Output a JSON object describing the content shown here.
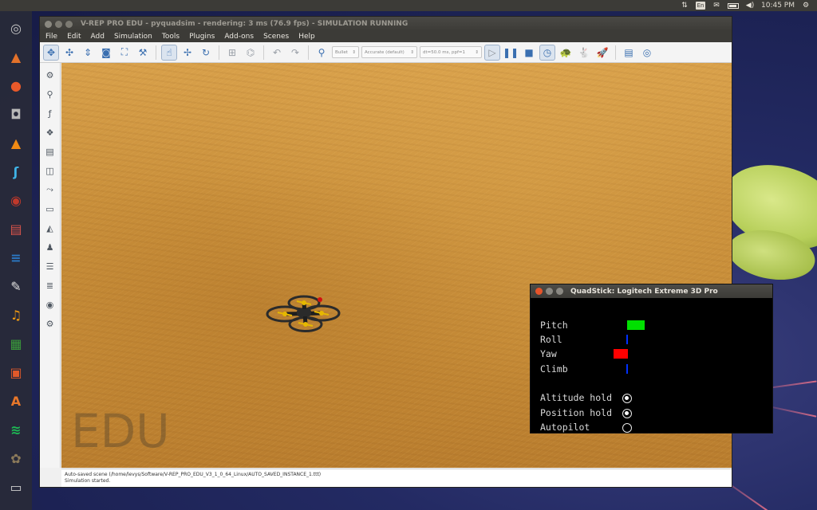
{
  "top_panel": {
    "keyboard_layout": "En",
    "clock": "10:45 PM",
    "icons": [
      "network-icon",
      "keyboard-icon",
      "mail-icon",
      "battery-icon",
      "volume-icon",
      "power-icon"
    ]
  },
  "launcher": {
    "items": [
      {
        "name": "ubuntu-dash-icon",
        "glyph": "◎",
        "color": "#c4c4c4"
      },
      {
        "name": "matlab-icon",
        "glyph": "▲",
        "color": "#e2712a"
      },
      {
        "name": "firefox-icon",
        "glyph": "●",
        "color": "#e8592a"
      },
      {
        "name": "camera-app-icon",
        "glyph": "◘",
        "color": "#b8b8b8"
      },
      {
        "name": "vlc-icon",
        "glyph": "▲",
        "color": "#f08a14"
      },
      {
        "name": "app-blue-icon",
        "glyph": "ʃ",
        "color": "#3fb4e8"
      },
      {
        "name": "app-red-icon",
        "glyph": "◉",
        "color": "#c0392b"
      },
      {
        "name": "files-icon",
        "glyph": "▤",
        "color": "#d9544a"
      },
      {
        "name": "writer-icon",
        "glyph": "≡",
        "color": "#2b78c4"
      },
      {
        "name": "editor-icon",
        "glyph": "✎",
        "color": "#e0e0e0"
      },
      {
        "name": "audacity-icon",
        "glyph": "♫",
        "color": "#f39c12"
      },
      {
        "name": "calc-icon",
        "glyph": "▦",
        "color": "#3a9b3a"
      },
      {
        "name": "impress-icon",
        "glyph": "▣",
        "color": "#e0592a"
      },
      {
        "name": "software-center-icon",
        "glyph": "A",
        "color": "#e8772a"
      },
      {
        "name": "spotify-icon",
        "glyph": "≋",
        "color": "#1db954"
      },
      {
        "name": "gimp-icon",
        "glyph": "✿",
        "color": "#8c7a5a"
      },
      {
        "name": "scanner-icon",
        "glyph": "▭",
        "color": "#cfcfcf"
      }
    ]
  },
  "main_window": {
    "title": "V-REP PRO EDU - pyquadsim - rendering: 3 ms (76.9 fps) - SIMULATION RUNNING",
    "menu": [
      "File",
      "Edit",
      "Add",
      "Simulation",
      "Tools",
      "Plugins",
      "Add-ons",
      "Scenes",
      "Help"
    ],
    "toolbar": {
      "engine_select": "Bullet",
      "accuracy_select": "Accurate (default)",
      "timestep_select": "dt=50.0 ms, ppf=1"
    },
    "watermark": "EDU",
    "status_lines": [
      "Auto-saved scene (/home/levys/Software/V-REP_PRO_EDU_V3_1_0_64_Linux/AUTO_SAVED_INSTANCE_1.ttt)",
      "Simulation started."
    ]
  },
  "quad_window": {
    "title": "QuadStick: Logitech Extreme 3D Pro",
    "axes": [
      {
        "label": "Pitch",
        "color": "#00e000"
      },
      {
        "label": "Roll",
        "color": "#0030ff"
      },
      {
        "label": "Yaw",
        "color": "#ff0000"
      },
      {
        "label": "Climb",
        "color": "#0030ff"
      }
    ],
    "modes": [
      {
        "label": "Altitude hold",
        "checked": true
      },
      {
        "label": "Position hold",
        "checked": true
      },
      {
        "label": "Autopilot",
        "checked": false
      }
    ]
  }
}
